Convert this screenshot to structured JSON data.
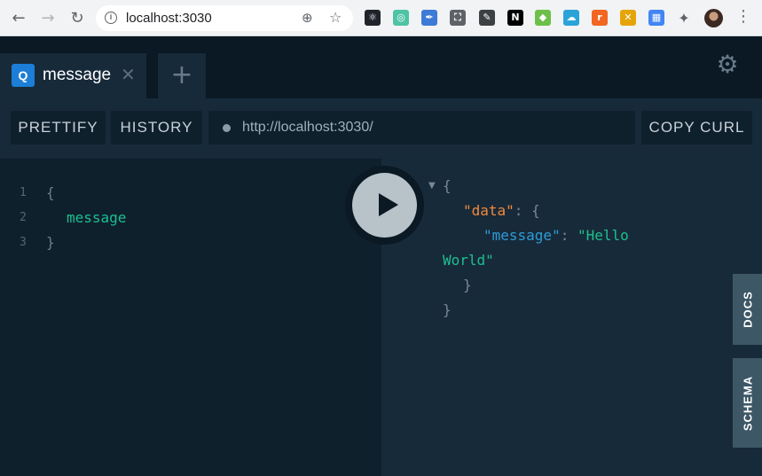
{
  "browser": {
    "url": "localhost:3030",
    "extensions": [
      {
        "name": "react-devtools-icon",
        "glyph": "⚛",
        "bg": "#20232a"
      },
      {
        "name": "extension-ring-icon",
        "glyph": "◎",
        "bg": "#4ec3a6"
      },
      {
        "name": "extension-feather-icon",
        "glyph": "✒",
        "bg": "#3c7bd6"
      },
      {
        "name": "screenshot-icon",
        "glyph": "⛶",
        "bg": "#5f6368"
      },
      {
        "name": "eyedropper-icon",
        "glyph": "✎",
        "bg": "#3c4043"
      },
      {
        "name": "notion-icon",
        "glyph": "N",
        "bg": "#000000"
      },
      {
        "name": "extension-cube-icon",
        "glyph": "◆",
        "bg": "#6cc04a"
      },
      {
        "name": "extension-cloud-icon",
        "glyph": "☁",
        "bg": "#2aa3d8"
      },
      {
        "name": "extension-r-icon",
        "glyph": "r",
        "bg": "#f26522"
      },
      {
        "name": "extension-x-icon",
        "glyph": "✕",
        "bg": "#e5a50a"
      },
      {
        "name": "calendar-icon",
        "glyph": "▦",
        "bg": "#4285f4"
      }
    ]
  },
  "playground": {
    "tab": {
      "badge": "Q",
      "title": "message"
    },
    "toolbar": {
      "prettify": "PRETTIFY",
      "history": "HISTORY",
      "endpoint": "http://localhost:3030/",
      "copy_curl": "COPY CURL"
    },
    "query": {
      "line_numbers": [
        "1",
        "2",
        "3"
      ],
      "open_brace": "{",
      "field": "message",
      "close_brace": "}"
    },
    "result": {
      "open": "{",
      "data_key": "\"data\"",
      "colon_open": ": {",
      "message_key": "\"message\"",
      "colon": ": ",
      "value_part1": "\"Hello",
      "value_part2": "World\"",
      "inner_close": "}",
      "outer_close": "}"
    },
    "side_tabs": {
      "docs": "DOCS",
      "schema": "SCHEMA"
    }
  }
}
